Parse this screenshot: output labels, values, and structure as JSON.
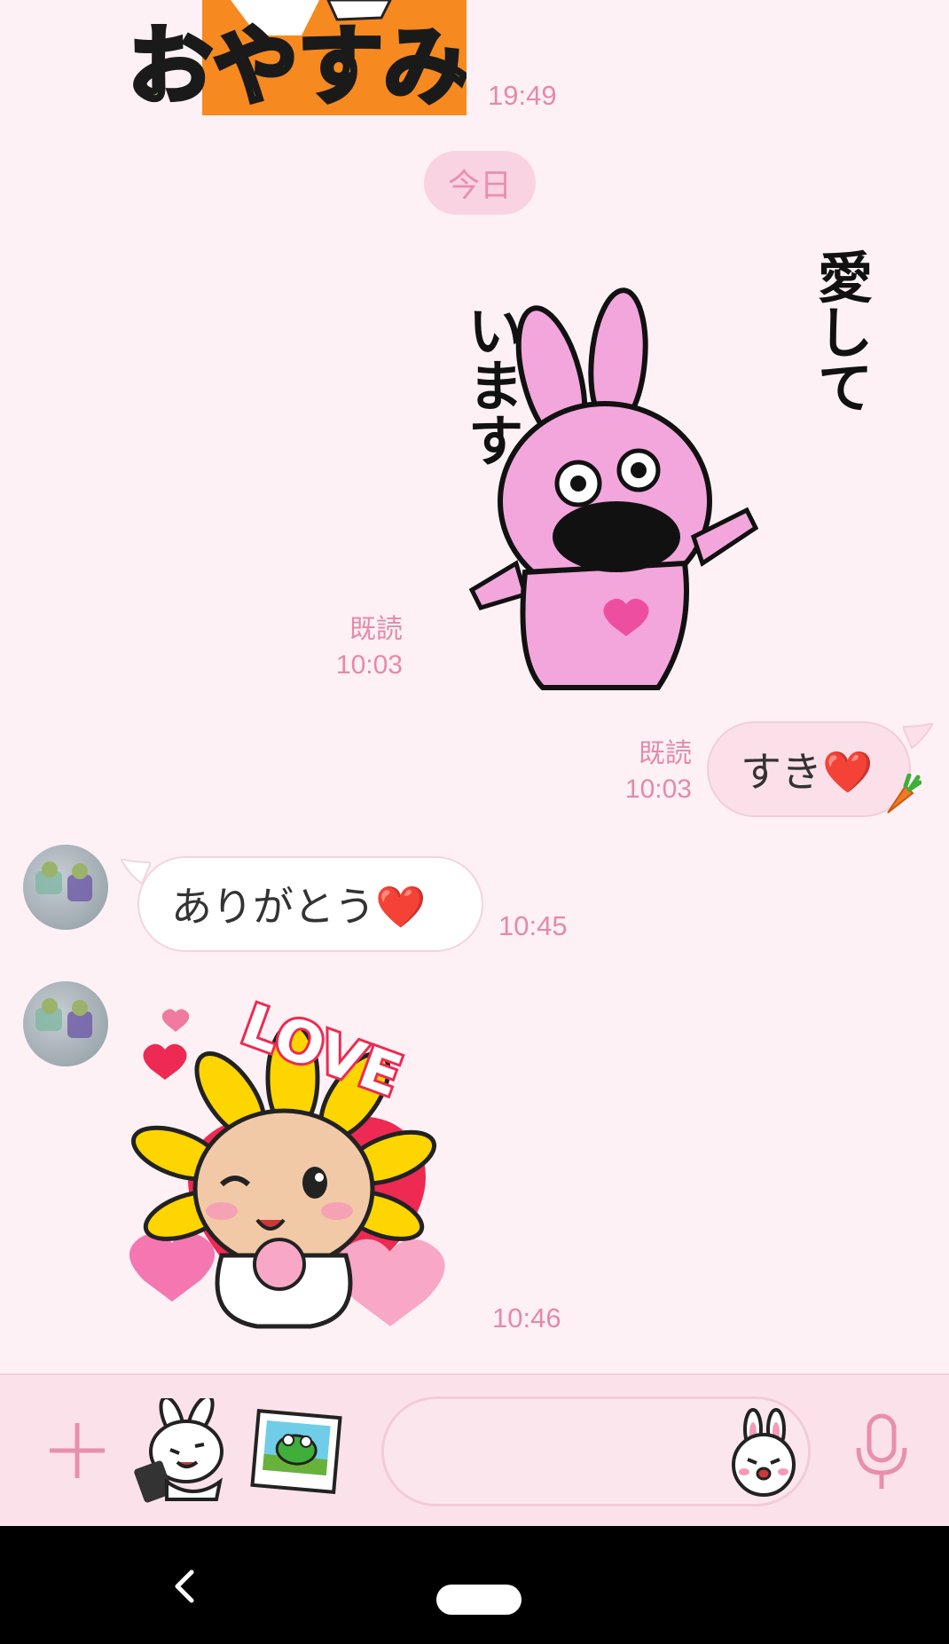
{
  "messages": {
    "m1_time": "19:49",
    "m1_sticker_text": "おやすみ",
    "date_separator": "今日",
    "m2_status": "既読",
    "m2_time": "10:03",
    "m2_sticker_text_a": "愛して",
    "m2_sticker_text_b": "います",
    "m3_text": "すき❤️",
    "m3_status": "既読",
    "m3_time": "10:03",
    "m4_text": "ありがとう❤️",
    "m4_time": "10:45",
    "m5_time": "10:46",
    "m5_sticker_text": "LOVE"
  },
  "input": {
    "placeholder": ""
  },
  "icons": {
    "add": "plus-icon",
    "sticker_shortcut": "sticker-icon",
    "photo": "photo-icon",
    "emoji": "emoji-icon",
    "mic": "microphone-icon",
    "back": "back-icon",
    "home": "home-pill-icon"
  },
  "colors": {
    "background": "#fdf1f5",
    "accent": "#e98fae",
    "outgoing_bubble": "#fbe0ea"
  }
}
